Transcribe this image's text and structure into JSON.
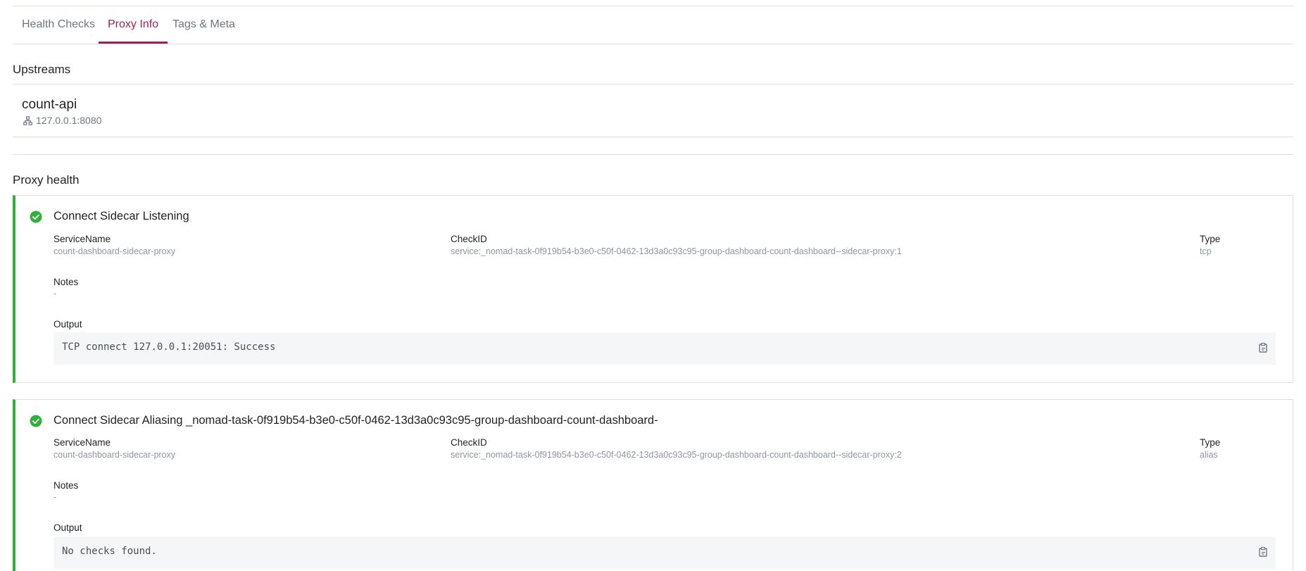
{
  "tabs": [
    {
      "label": "Health Checks",
      "active": false
    },
    {
      "label": "Proxy Info",
      "active": true
    },
    {
      "label": "Tags & Meta",
      "active": false
    }
  ],
  "upstreams": {
    "title": "Upstreams",
    "items": [
      {
        "name": "count-api",
        "address": "127.0.0.1:8080",
        "icon": "network-icon"
      }
    ]
  },
  "proxy_health": {
    "title": "Proxy health",
    "checks": [
      {
        "title": "Connect Sidecar Listening",
        "status": "passing",
        "service_name_label": "ServiceName",
        "service_name": "count-dashboard-sidecar-proxy",
        "check_id_label": "CheckID",
        "check_id": "service:_nomad-task-0f919b54-b3e0-c50f-0462-13d3a0c93c95-group-dashboard-count-dashboard--sidecar-proxy:1",
        "type_label": "Type",
        "type": "tcp",
        "notes_label": "Notes",
        "notes": "-",
        "output_label": "Output",
        "output": "TCP connect 127.0.0.1:20051: Success"
      },
      {
        "title": "Connect Sidecar Aliasing _nomad-task-0f919b54-b3e0-c50f-0462-13d3a0c93c95-group-dashboard-count-dashboard-",
        "status": "passing",
        "service_name_label": "ServiceName",
        "service_name": "count-dashboard-sidecar-proxy",
        "check_id_label": "CheckID",
        "check_id": "service:_nomad-task-0f919b54-b3e0-c50f-0462-13d3a0c93c95-group-dashboard-count-dashboard--sidecar-proxy:2",
        "type_label": "Type",
        "type": "alias",
        "notes_label": "Notes",
        "notes": "-",
        "output_label": "Output",
        "output": "No checks found."
      }
    ]
  },
  "colors": {
    "accent": "#9e2159",
    "passing": "#2eb039",
    "border": "#dcdee3",
    "muted_text": "#8e96a3"
  }
}
